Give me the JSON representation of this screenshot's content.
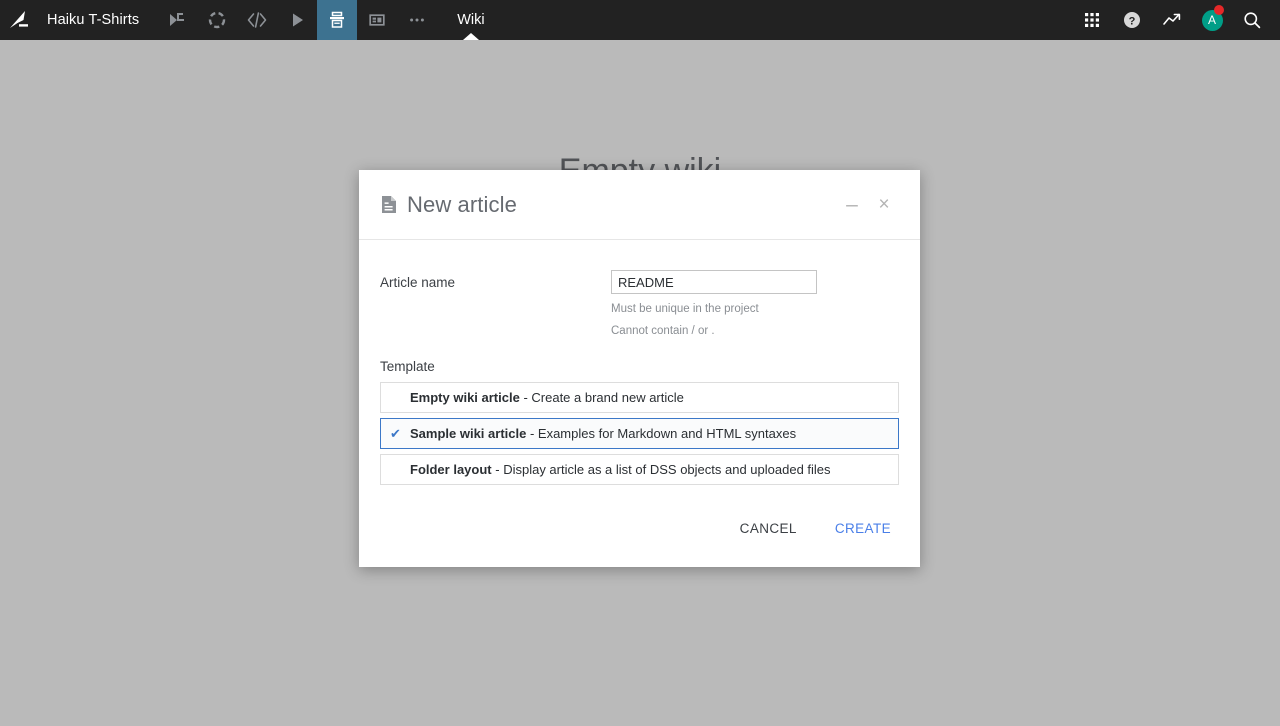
{
  "topbar": {
    "logo_icon": "dataiku-logo-icon",
    "project_name": "Haiku T-Shirts",
    "nav_icons": [
      {
        "name": "flow-icon",
        "label": "Flow"
      },
      {
        "name": "lab-icon",
        "label": "Lab"
      },
      {
        "name": "code-icon",
        "label": "Code"
      },
      {
        "name": "automation-icon",
        "label": "Automation"
      },
      {
        "name": "wiki-icon",
        "label": "Wiki",
        "active": true
      },
      {
        "name": "dashboard-icon",
        "label": "Dashboard"
      },
      {
        "name": "more-icon",
        "label": "More"
      }
    ],
    "active_tab": "Wiki",
    "right_icons": [
      {
        "name": "apps-grid-icon",
        "label": "Apps"
      },
      {
        "name": "help-icon",
        "label": "Help"
      },
      {
        "name": "activity-trend-icon",
        "label": "Activity"
      }
    ],
    "avatar": {
      "initial": "A",
      "has_notification": true,
      "color": "#009e87",
      "badge_color": "#e52828"
    },
    "search_icon": "search-icon",
    "background_color": "#222222",
    "active_icon_color": "#3d7290"
  },
  "page": {
    "background_title": "Empty wiki"
  },
  "modal": {
    "icon": "document-icon",
    "title": "New article",
    "minimize_label": "–",
    "close_label": "×",
    "article_name": {
      "label": "Article name",
      "value": "README",
      "placeholder": "",
      "hints": [
        "Must be unique in the project",
        "Cannot contain / or ."
      ]
    },
    "template": {
      "label": "Template",
      "options": [
        {
          "title": "Empty wiki article",
          "description": "- Create a brand new article",
          "selected": false
        },
        {
          "title": "Sample wiki article",
          "description": "- Examples for Markdown and HTML syntaxes",
          "selected": true
        },
        {
          "title": "Folder layout",
          "description": "- Display article as a list of DSS objects and uploaded files",
          "selected": false
        }
      ],
      "check_glyph": "✔"
    },
    "footer": {
      "cancel_label": "CANCEL",
      "create_label": "CREATE",
      "create_color": "#4a7fe8"
    }
  }
}
